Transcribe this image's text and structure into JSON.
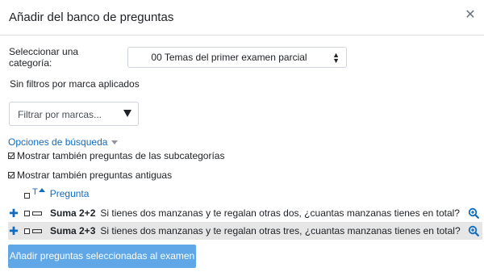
{
  "modal": {
    "title": "Añadir del banco de preguntas"
  },
  "category": {
    "label": "Seleccionar una categoría:",
    "selected": "00 Temas del primer examen parcial"
  },
  "filters": {
    "none_applied": "Sin filtros por marca aplicados",
    "tag_placeholder": "Filtrar por marcas..."
  },
  "search_options": {
    "label": "Opciones de búsqueda",
    "show_subcategories": "Mostrar también preguntas de las subcategorías",
    "show_old": "Mostrar también preguntas antiguas",
    "show_subcategories_checked": true,
    "show_old_checked": true
  },
  "table": {
    "col_type": "T",
    "col_question": "Pregunta",
    "rows": [
      {
        "name": "Suma 2+2",
        "text": "Si tienes dos manzanas y te regalan otras dos, ¿cuantas manzanas tienes en total?"
      },
      {
        "name": "Suma 2+3",
        "text": "Si tienes dos manzanas y te regalan otras tres, ¿cuantas manzanas tienes en total?"
      }
    ]
  },
  "actions": {
    "add_selected": "Añadir preguntas seleccionadas al examen"
  },
  "colors": {
    "link": "#0f6cbf",
    "button_disabled": "#5fa7e6",
    "row_highlight": "#e6e6e6"
  },
  "icons": {
    "close": "close-icon",
    "add": "plus-icon",
    "preview": "magnifier-plus-icon",
    "sort": "sort-asc-icon",
    "select_caret": "updown-caret-icon"
  }
}
